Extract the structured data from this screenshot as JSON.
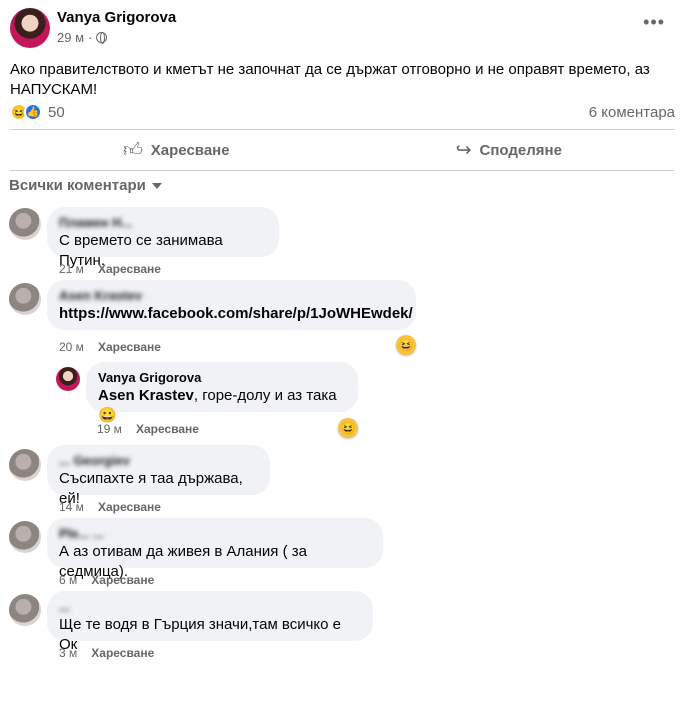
{
  "post": {
    "author": "Vanya Grigorova",
    "time": "29 м",
    "dot": "·",
    "text": "Ако правителството и кметът не започнат да се държат отговорно и не оправят времето, аз НАПУСКАМ!",
    "reaction_count": "50",
    "comments_count": "6 коментара"
  },
  "actions": {
    "like": "Харесване",
    "share": "Споделяне"
  },
  "filter_label": "Всички коментари",
  "comments": [
    {
      "name": "Пламен Н...",
      "text": "С времето се занимава Путин.",
      "time": "21 м",
      "like": "Харесване"
    },
    {
      "name": "Asen Krastev",
      "text": "https://www.facebook.com/share/p/1JoWHEwdek/",
      "time": "20 м",
      "like": "Харесване"
    },
    {
      "name": "Vanya Grigorova",
      "mention": "Asen Krastev",
      "text": ", горе-долу и аз така 😀",
      "time": "19 м",
      "like": "Харесване"
    },
    {
      "name": "... Georgiev",
      "text": "Съсипахте я таа държава, ей!",
      "time": "14 м",
      "like": "Харесване"
    },
    {
      "name": "Ple... ...",
      "text": "А аз отивам да живея в Алания ( за седмица).",
      "time": "6 м",
      "like": "Харесване"
    },
    {
      "name": "...",
      "text": "Ще те водя в Гърция значи,там всичко е Ок",
      "time": "3 м",
      "like": "Харесване"
    }
  ],
  "icons": [
    "globe-icon",
    "more-icon",
    "haha-reaction-icon",
    "like-reaction-icon",
    "thumbs-up-icon",
    "share-icon",
    "caret-down-icon"
  ],
  "colors": {
    "text": "#050505",
    "secondary": "#65676b",
    "bubble": "#f0f2f5",
    "accent": "#1877f2",
    "divider": "#ced0d4"
  }
}
